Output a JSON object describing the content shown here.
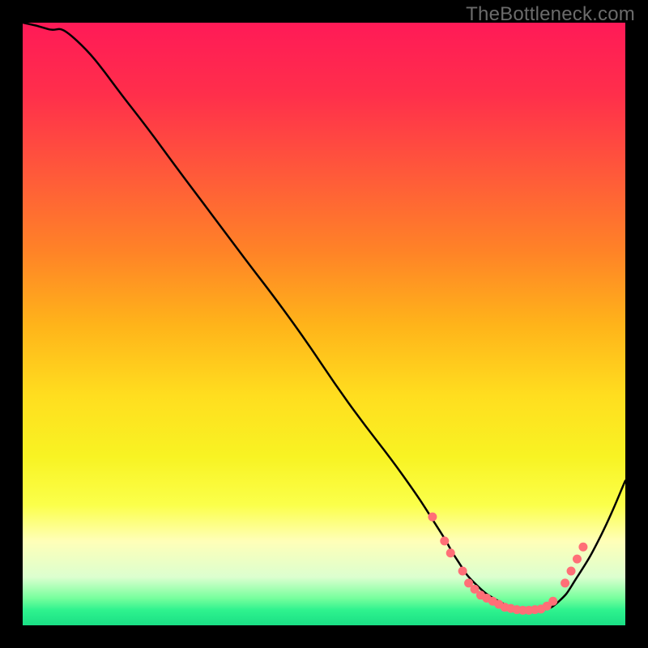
{
  "watermark": "TheBottleneck.com",
  "colors": {
    "background": "#000000",
    "curve": "#000000",
    "dot": "#ff6f77",
    "gradient_stops": [
      {
        "offset": 0.0,
        "color": "#ff1a57"
      },
      {
        "offset": 0.12,
        "color": "#ff2f4b"
      },
      {
        "offset": 0.25,
        "color": "#ff593a"
      },
      {
        "offset": 0.38,
        "color": "#ff8327"
      },
      {
        "offset": 0.5,
        "color": "#ffb31a"
      },
      {
        "offset": 0.62,
        "color": "#ffde1f"
      },
      {
        "offset": 0.72,
        "color": "#f8f323"
      },
      {
        "offset": 0.8,
        "color": "#fbff4a"
      },
      {
        "offset": 0.86,
        "color": "#ffffb8"
      },
      {
        "offset": 0.92,
        "color": "#dcffcf"
      },
      {
        "offset": 0.955,
        "color": "#77ff9d"
      },
      {
        "offset": 0.975,
        "color": "#2ef28e"
      },
      {
        "offset": 1.0,
        "color": "#1adf85"
      }
    ]
  },
  "chart_data": {
    "type": "line",
    "title": "",
    "xlabel": "",
    "ylabel": "",
    "xlim": [
      0,
      100
    ],
    "ylim": [
      0,
      100
    ],
    "grid": false,
    "series": [
      {
        "name": "curve",
        "x": [
          0,
          4,
          9,
          18,
          27,
          36,
          45,
          54,
          63,
          69,
          72,
          75,
          79,
          83,
          86,
          89,
          92,
          96,
          100
        ],
        "y": [
          100,
          99,
          97,
          86,
          74,
          62,
          50,
          37,
          25,
          16,
          11,
          7,
          4,
          2.5,
          2.5,
          4,
          8,
          15,
          24
        ]
      }
    ],
    "highlight_points": [
      {
        "x": 68,
        "y": 18
      },
      {
        "x": 70,
        "y": 14
      },
      {
        "x": 71,
        "y": 12
      },
      {
        "x": 73,
        "y": 9
      },
      {
        "x": 74,
        "y": 7
      },
      {
        "x": 75,
        "y": 6
      },
      {
        "x": 76,
        "y": 5
      },
      {
        "x": 77,
        "y": 4.5
      },
      {
        "x": 78,
        "y": 4
      },
      {
        "x": 79,
        "y": 3.5
      },
      {
        "x": 80,
        "y": 3
      },
      {
        "x": 81,
        "y": 2.8
      },
      {
        "x": 82,
        "y": 2.6
      },
      {
        "x": 83,
        "y": 2.5
      },
      {
        "x": 84,
        "y": 2.5
      },
      {
        "x": 85,
        "y": 2.6
      },
      {
        "x": 86,
        "y": 2.7
      },
      {
        "x": 87,
        "y": 3.2
      },
      {
        "x": 88,
        "y": 4
      },
      {
        "x": 90,
        "y": 7
      },
      {
        "x": 91,
        "y": 9
      },
      {
        "x": 92,
        "y": 11
      },
      {
        "x": 93,
        "y": 13
      }
    ]
  }
}
